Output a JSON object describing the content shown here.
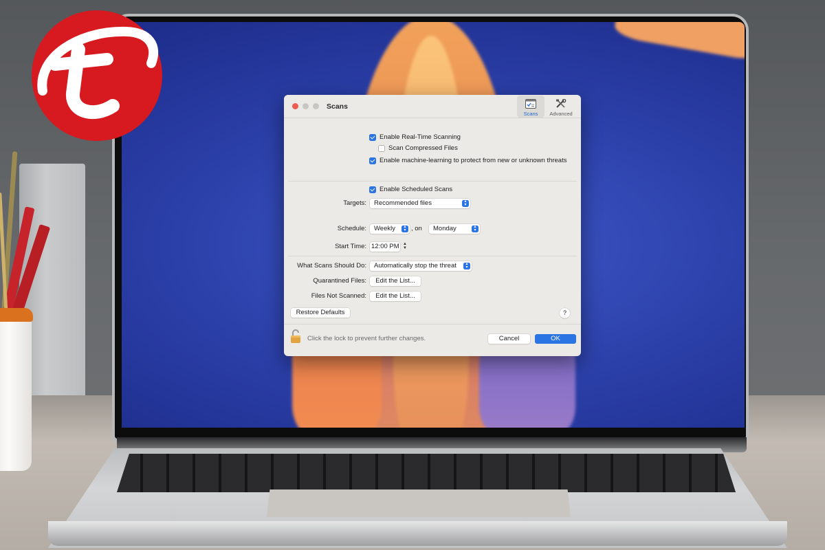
{
  "dialog": {
    "title": "Scans",
    "tabs": [
      {
        "label": "Scans",
        "active": true
      },
      {
        "label": "Advanced",
        "active": false
      }
    ],
    "realtime": {
      "enable_realtime": {
        "label": "Enable Real-Time Scanning",
        "checked": true
      },
      "scan_compressed": {
        "label": "Scan Compressed Files",
        "checked": false
      },
      "machine_learning": {
        "label": "Enable machine-learning to protect from new or unknown threats",
        "checked": true
      }
    },
    "scheduled": {
      "enable_scheduled": {
        "label": "Enable Scheduled Scans",
        "checked": true
      },
      "targets_label": "Targets:",
      "targets_value": "Recommended files",
      "schedule_label": "Schedule:",
      "schedule_value": "Weekly",
      "on_label": ", on",
      "day_value": "Monday",
      "start_time_label": "Start Time:",
      "start_time_value": "12:00 PM"
    },
    "actions": {
      "what_scans_label": "What Scans Should Do:",
      "what_scans_value": "Automatically stop the threat",
      "quarantined_label": "Quarantined Files:",
      "quarantined_button": "Edit the List...",
      "not_scanned_label": "Files Not Scanned:",
      "not_scanned_button": "Edit the List..."
    },
    "restore_defaults": "Restore Defaults",
    "help": "?",
    "lock_text": "Click the lock to prevent further changes.",
    "cancel": "Cancel",
    "ok": "OK"
  },
  "colors": {
    "accent": "#2b74e3",
    "logo_red": "#d71920",
    "window_bg": "#eceae7"
  },
  "icons": [
    "scans-tab-icon",
    "advanced-tab-icon",
    "unlocked-padlock-icon",
    "trend-micro-logo"
  ]
}
